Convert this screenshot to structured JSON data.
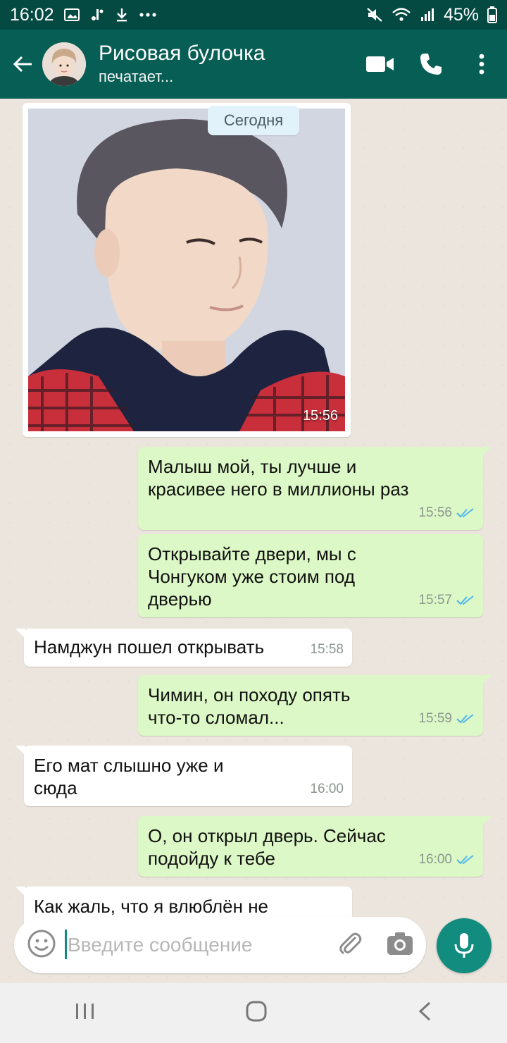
{
  "status_bar": {
    "time": "16:02",
    "battery": "45%",
    "icons": [
      "gallery-icon",
      "notification-icon",
      "download-icon",
      "more-dots-icon",
      "mute-icon",
      "wifi-icon",
      "signal-icon"
    ]
  },
  "header": {
    "contact_name": "Рисовая булочка",
    "status": "печатает...",
    "icons": [
      "back-arrow-icon",
      "avatar",
      "video-call-icon",
      "phone-icon",
      "menu-dots-icon"
    ]
  },
  "chat": {
    "date_chip": "Сегодня",
    "photo_message": {
      "time": "15:56"
    },
    "messages": [
      {
        "direction": "out",
        "text": "Малыш мой, ты лучше и красивее него в миллионы раз",
        "time": "15:56",
        "read": true
      },
      {
        "direction": "out",
        "text": "Открывайте двери, мы с Чонгуком уже стоим под дверью",
        "time": "15:57",
        "read": true
      },
      {
        "direction": "in",
        "text": "Намджун пошел открывать",
        "time": "15:58"
      },
      {
        "direction": "out",
        "text": "Чимин, он походу опять что-то сломал...",
        "time": "15:59",
        "read": true
      },
      {
        "direction": "in",
        "text": "Его мат слышно уже и сюда",
        "time": "16:00"
      },
      {
        "direction": "out",
        "text": "О, он открыл дверь. Сейчас подойду к тебе",
        "time": "16:00",
        "read": true
      },
      {
        "direction": "in",
        "text": "Как жаль, что я влюблён не",
        "time": ""
      }
    ]
  },
  "composer": {
    "placeholder": "Введите сообщение",
    "icons": [
      "emoji-icon",
      "attach-icon",
      "camera-icon",
      "mic-icon"
    ]
  },
  "colors": {
    "header": "#075e54",
    "status_bar": "#044a43",
    "outgoing_bubble": "#dcf8c6",
    "incoming_bubble": "#ffffff",
    "read_ticks": "#4fb6ec",
    "accent": "#128c7e"
  },
  "nav": {
    "icons": [
      "recent-apps-icon",
      "home-icon",
      "back-icon"
    ]
  }
}
